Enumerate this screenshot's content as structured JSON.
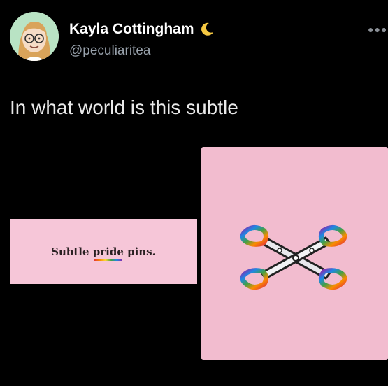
{
  "user": {
    "display_name": "Kayla Cottingham",
    "name_emoji": "moon-icon",
    "handle": "@peculiaritea"
  },
  "tweet": {
    "text": "In what world is this subtle"
  },
  "images": {
    "left_caption": "Subtle pride pins.",
    "right_subject": "rainbow-scissors-pin"
  },
  "colors": {
    "background": "#000000",
    "card_pink": "#f6c6d8",
    "photo_pink": "#f2bccf",
    "handle_gray": "#9aa3ad"
  }
}
